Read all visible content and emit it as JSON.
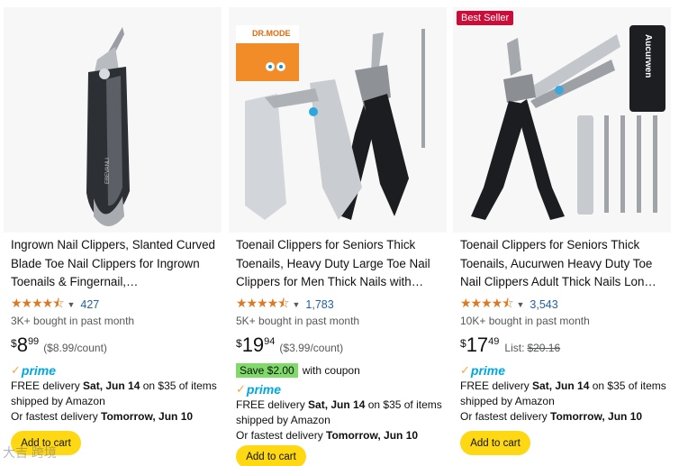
{
  "cards": [
    {
      "badge": "",
      "title": "Ingrown Nail Clippers, Slanted Curved Blade Toe Nail Clippers for Ingrown Toenails & Fingernail,…",
      "rating_count": "427",
      "bought": "3K+ bought in past month",
      "price_symbol": "$",
      "price_whole": "8",
      "price_fraction": "99",
      "price_unit": "($8.99/count)",
      "list_label": "",
      "list_price": "",
      "coupon_save": "",
      "coupon_text": "",
      "prime": "prime",
      "delivery_prefix": "FREE delivery ",
      "delivery_date": "Sat, Jun 14",
      "delivery_suffix": " on $35 of items shipped by Amazon",
      "fastest_prefix": "Or fastest delivery ",
      "fastest_date": "Tomorrow, Jun 10",
      "cart_label": "Add to cart",
      "rating": 4.5
    },
    {
      "badge": "",
      "title": "Toenail Clippers for Seniors Thick Toenails, Heavy Duty Large Toe Nail Clippers for Men Thick Nails with…",
      "rating_count": "1,783",
      "bought": "5K+ bought in past month",
      "price_symbol": "$",
      "price_whole": "19",
      "price_fraction": "94",
      "price_unit": "($3.99/count)",
      "list_label": "",
      "list_price": "",
      "coupon_save": "Save $2.00",
      "coupon_text": "with coupon",
      "prime": "prime",
      "delivery_prefix": "FREE delivery ",
      "delivery_date": "Sat, Jun 14",
      "delivery_suffix": " on $35 of items shipped by Amazon",
      "fastest_prefix": "Or fastest delivery ",
      "fastest_date": "Tomorrow, Jun 10",
      "cart_label": "Add to cart",
      "rating": 4.5,
      "brand_box": "DR.MODE"
    },
    {
      "badge": "Best Seller",
      "title": "Toenail Clippers for Seniors Thick Toenails, Aucurwen Heavy Duty Toe Nail Clippers Adult Thick Nails Lon…",
      "rating_count": "3,543",
      "bought": "10K+ bought in past month",
      "price_symbol": "$",
      "price_whole": "17",
      "price_fraction": "49",
      "price_unit": "",
      "list_label": "List:",
      "list_price": "$20.16",
      "coupon_save": "",
      "coupon_text": "",
      "prime": "prime",
      "delivery_prefix": "FREE delivery ",
      "delivery_date": "Sat, Jun 14",
      "delivery_suffix": " on $35 of items shipped by Amazon",
      "fastest_prefix": "Or fastest delivery ",
      "fastest_date": "Tomorrow, Jun 10",
      "cart_label": "Add to cart",
      "rating": 4.5,
      "case_brand": "Aucurwen"
    }
  ],
  "icons": {
    "star": "star-icon",
    "chevron": "chevron-down-icon",
    "prime_check": "prime-check-icon"
  },
  "colors": {
    "star": "#de7921",
    "link": "#2162a1",
    "cart": "#ffd814",
    "badge": "#cc0c39",
    "coupon": "#7fda69",
    "prime": "#00a8e1"
  },
  "stars_text": "★★★★⯪",
  "watermark": "大吉 跨境"
}
